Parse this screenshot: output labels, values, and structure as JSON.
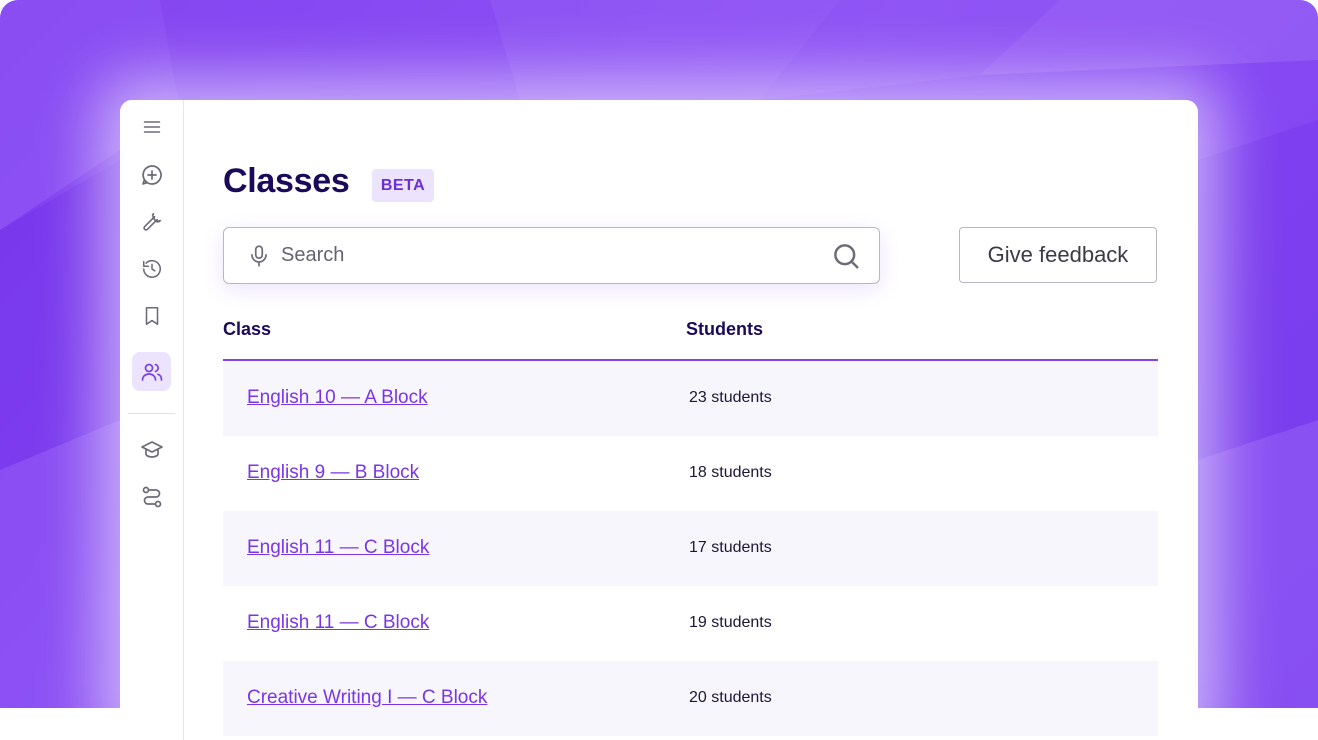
{
  "page": {
    "title": "Classes",
    "badge": "BETA"
  },
  "search": {
    "placeholder": "Search",
    "value": ""
  },
  "feedback_button": {
    "label": "Give feedback"
  },
  "sidebar": {
    "items": [
      {
        "icon": "menu-icon",
        "active": false
      },
      {
        "icon": "new-chat-icon",
        "active": false
      },
      {
        "icon": "wrench-icon",
        "active": false
      },
      {
        "icon": "history-icon",
        "active": false
      },
      {
        "icon": "bookmark-icon",
        "active": false
      },
      {
        "icon": "users-icon",
        "active": true
      },
      {
        "icon": "graduation-cap-icon",
        "active": false
      },
      {
        "icon": "route-icon",
        "active": false
      }
    ]
  },
  "table": {
    "headers": [
      "Class",
      "Students"
    ],
    "rows": [
      {
        "class": "English 10  — A Block",
        "students": "23 students"
      },
      {
        "class": "English 9  — B Block",
        "students": "18 students"
      },
      {
        "class": "English 11  — C Block",
        "students": "17 students"
      },
      {
        "class": "English 11  — C Block",
        "students": "19 students"
      },
      {
        "class": "Creative Writing I  — C Block",
        "students": "20 students"
      }
    ]
  },
  "colors": {
    "accent": "#7b3fe4",
    "title": "#1b0a5a",
    "backdrop": "#8a4cf5",
    "row_shade": "#f8f6fd"
  }
}
